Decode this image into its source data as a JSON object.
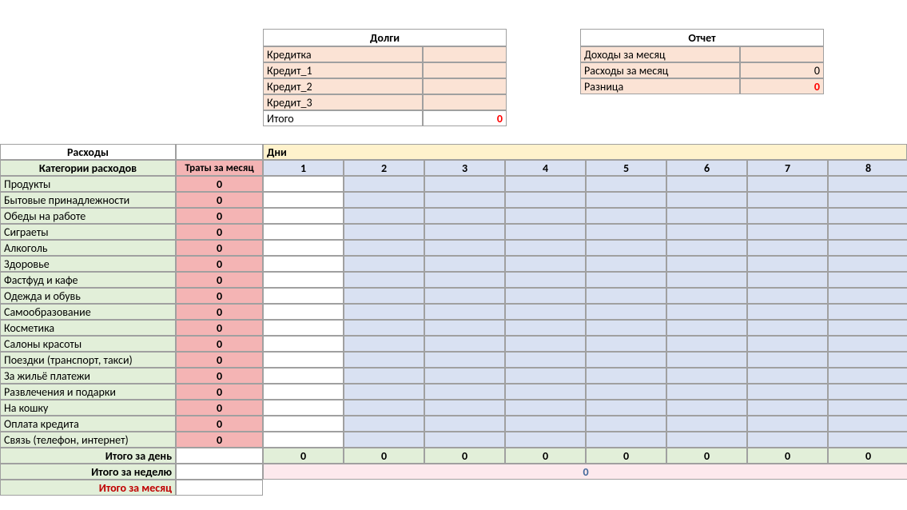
{
  "debts": {
    "title": "Долги",
    "rows": [
      {
        "label": "Кредитка",
        "value": ""
      },
      {
        "label": "Кредит_1",
        "value": ""
      },
      {
        "label": "Кредит_2",
        "value": ""
      },
      {
        "label": "Кредит_3",
        "value": ""
      }
    ],
    "total_label": "Итого",
    "total_value": "0"
  },
  "report": {
    "title": "Отчет",
    "rows": [
      {
        "label": "Доходы за месяц",
        "value": ""
      },
      {
        "label": "Расходы за месяц",
        "value": "0"
      },
      {
        "label": "Разница",
        "value": "0"
      }
    ]
  },
  "expenses": {
    "title": "Расходы",
    "cat_header": "Категории расходов",
    "month_spend_header": "Траты за месяц",
    "days_header": "Дни",
    "days": [
      "1",
      "2",
      "3",
      "4",
      "5",
      "6",
      "7",
      "8"
    ],
    "per_day_label": "Итого за день",
    "per_day_values": [
      "0",
      "0",
      "0",
      "0",
      "0",
      "0",
      "0",
      "0"
    ],
    "per_week_label": "Итого за неделю",
    "per_week_value": "0",
    "per_month_label": "Итого за месяц",
    "categories": [
      "Продукты",
      "Бытовые принадлежности",
      "Обеды на работе",
      "Сиграеты",
      "Алкоголь",
      "Здоровье",
      "Фастфуд и кафе",
      "Одежда и обувь",
      "Самообразование",
      "Косметика",
      "Салоны красоты",
      "Поездки (транспорт, такси)",
      "За жильё платежи",
      "Развлечения и подарки",
      "На кошку",
      "Оплата кредита",
      "Связь (телефон, интернет)"
    ],
    "month_spend_zero": "0"
  }
}
